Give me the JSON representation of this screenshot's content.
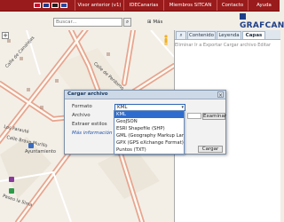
{
  "nav": {
    "flags": [
      {
        "name": "flag-es",
        "color": "#c8102e"
      },
      {
        "name": "flag-uk",
        "color": "#1f3c88"
      },
      {
        "name": "flag-de",
        "color": "#222222"
      },
      {
        "name": "flag-fr",
        "color": "#2a4aa0"
      }
    ],
    "items": [
      "Visor anterior (v1)",
      "IDECanarias",
      "Miembros SITCAN",
      "Contacto",
      "Ayuda"
    ]
  },
  "search": {
    "placeholder": "Buscar...",
    "more_label": "Más",
    "logo_text": "GRAFCAN"
  },
  "panel": {
    "tabs": [
      "Contenido",
      "Leyenda",
      "Capas"
    ],
    "active_tab": "Capas",
    "tools": "Eliminar  Ir a  Exportar  Cargar archivo  Editar"
  },
  "map": {
    "labels": [
      "Calle de Canalejas",
      "Calle de Perdomo",
      "Los Farauté",
      "Calle Bravo Murillo",
      "Ayuntamiento",
      "Paseo la Sima"
    ]
  },
  "dialog": {
    "title": "Cargar archivo",
    "format_label": "Formato",
    "format_value": "KML",
    "file_label": "Archivo",
    "styles_label": "Extraer estilos",
    "more_info": "Más información",
    "browse_button": "Examinar",
    "load_button": "Cargar",
    "options": [
      "KML",
      "GeoJSON",
      "ESRI Shapefile (SHP)",
      "GML (Geography Markup Langu...",
      "GPX (GPS eXchange Format)",
      "Puntos (TXT)"
    ]
  },
  "colors": {
    "nav_bg": "#9a1b1b",
    "accent": "#2f6ccf",
    "map_bg": "#f3efe7"
  }
}
